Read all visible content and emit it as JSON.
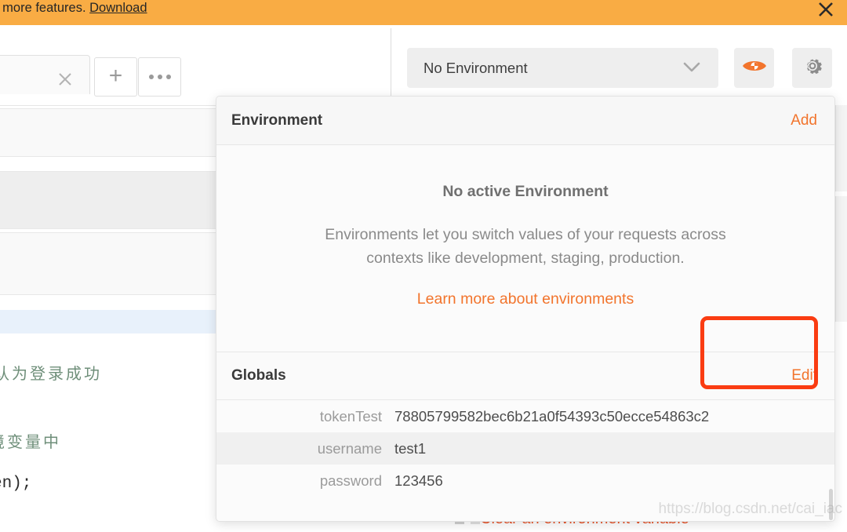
{
  "banner": {
    "text_before_link": "t more features. ",
    "link_label": "Download",
    "close_icon": "close-icon",
    "background_color": "#f9ac44"
  },
  "toolbar": {
    "tab_close_icon": "close-icon",
    "new_tab_label": "+",
    "tab_options_label": "•••",
    "environment_selector": {
      "selected_value": "No Environment",
      "caret_icon": "chevron-down-icon"
    },
    "quick_look_icon": "eye-icon",
    "settings_icon": "gear-icon",
    "accent_color": "#f2742c"
  },
  "background": {
    "code_comment_1": "认为登录成功",
    "code_comment_2": "境变量中",
    "code_line_3": "en);",
    "clear_env_variable_label": "Clear an environment variable"
  },
  "popup": {
    "header": {
      "title": "Environment",
      "add_label": "Add"
    },
    "empty_state": {
      "headline": "No active Environment",
      "body_line_1": "Environments let you switch values of your requests across",
      "body_line_2": "contexts like development, staging, production.",
      "learn_more_label": "Learn more about environments"
    },
    "globals": {
      "title": "Globals",
      "edit_label": "Edit",
      "variables": [
        {
          "key": "tokenTest",
          "value": "78805799582bec6b21a0f54393c50ecce54863c2"
        },
        {
          "key": "username",
          "value": "test1"
        },
        {
          "key": "password",
          "value": "123456"
        }
      ]
    }
  },
  "annotation": {
    "target": "Edit",
    "color": "#fa3c12"
  },
  "watermark": {
    "text": "https://blog.csdn.net/cai_iac"
  }
}
